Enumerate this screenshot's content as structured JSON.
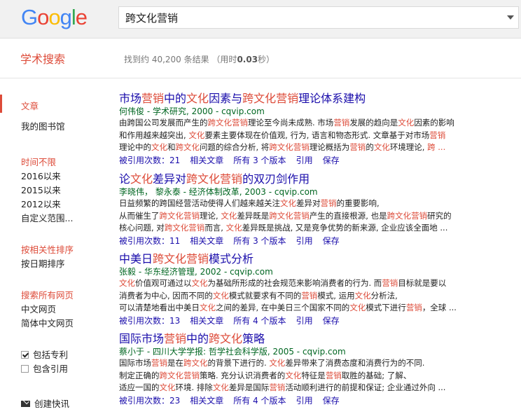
{
  "header": {
    "logo_letters": [
      {
        "ch": "G",
        "color": "#4285F4"
      },
      {
        "ch": "o",
        "color": "#EA4335"
      },
      {
        "ch": "o",
        "color": "#FBBC05"
      },
      {
        "ch": "g",
        "color": "#4285F4"
      },
      {
        "ch": "l",
        "color": "#34A853"
      },
      {
        "ch": "e",
        "color": "#EA4335"
      }
    ],
    "search_value": "跨文化营销"
  },
  "subbar": {
    "title": "学术搜索",
    "count_prefix": "找到约 40,200 条结果 （用时",
    "count_time": "0.03",
    "count_suffix": "秒）"
  },
  "sidebar": {
    "articles": "文章",
    "library": "我的图书馆",
    "time_header": "时间不限",
    "since_2016": "2016以来",
    "since_2015": "2015以来",
    "since_2012": "2012以来",
    "custom_range": "自定义范围...",
    "sort_relevance": "按相关性排序",
    "sort_date": "按日期排序",
    "search_all": "搜索所有网页",
    "chinese_pages": "中文网页",
    "simplified_pages": "简体中文网页",
    "include_patents": "包括专利",
    "include_citations": "包含引用",
    "create_alert": "创建快讯"
  },
  "results": [
    {
      "title": [
        [
          "市场",
          ""
        ],
        [
          "营销",
          "hl"
        ],
        [
          "中的",
          ""
        ],
        [
          "文化",
          "hl"
        ],
        [
          "因素与",
          ""
        ],
        [
          "跨文化营销",
          "hl"
        ],
        [
          "理论体系建构",
          ""
        ]
      ],
      "meta": "何伟俊 - 学术研究, 2000 - cqvip.com",
      "snippet": [
        [
          [
            "由跨国公司发展而产生的",
            ""
          ],
          [
            "跨文化营销",
            "hl"
          ],
          [
            "理论至今尚未成熟. 市场",
            ""
          ],
          [
            "营销",
            "hl"
          ],
          [
            "发展的趋向是",
            ""
          ],
          [
            "文化",
            "hl"
          ],
          [
            "因素的影响",
            ""
          ]
        ],
        [
          [
            "和作用越来越突出, ",
            ""
          ],
          [
            "文化",
            "hl"
          ],
          [
            "要素主要体现在价值观, 行为, 语言和物态形式. 文章基于对市场",
            ""
          ],
          [
            "营销",
            "hl"
          ]
        ],
        [
          [
            "理论中的",
            ""
          ],
          [
            "文化",
            "hl"
          ],
          [
            "和",
            ""
          ],
          [
            "跨文化",
            "hl"
          ],
          [
            "问题的综合分析, 将",
            ""
          ],
          [
            "跨文化营销",
            "hl"
          ],
          [
            "理论概括为",
            ""
          ],
          [
            "营销",
            "hl"
          ],
          [
            "的",
            ""
          ],
          [
            "文化",
            "hl"
          ],
          [
            "环境理论, ",
            ""
          ],
          [
            "跨 ...",
            "hl"
          ]
        ]
      ],
      "links": [
        "被引用次数：21",
        "相关文章",
        "所有 3 个版本",
        "引用",
        "保存"
      ]
    },
    {
      "title": [
        [
          "论",
          ""
        ],
        [
          "文化",
          "hl"
        ],
        [
          "差异对",
          ""
        ],
        [
          "跨文化营销",
          "hl"
        ],
        [
          "的双刃剑作用",
          ""
        ]
      ],
      "meta": "李晓伟， 黎永泰 - 经济体制改革, 2003 - cqvip.com",
      "snippet": [
        [
          [
            "日益频繁的跨国经营活动使得人们越来越关注",
            ""
          ],
          [
            "文化",
            "hl"
          ],
          [
            "差异对",
            ""
          ],
          [
            "营销",
            "hl"
          ],
          [
            "的重要影响,",
            ""
          ]
        ],
        [
          [
            "从而催生了",
            ""
          ],
          [
            "跨文化营销",
            "hl"
          ],
          [
            "理论, ",
            ""
          ],
          [
            "文化",
            "hl"
          ],
          [
            "差异既是",
            ""
          ],
          [
            "跨文化营销",
            "hl"
          ],
          [
            "产生的直接根源, 也是",
            ""
          ],
          [
            "跨文化营销",
            "hl"
          ],
          [
            "研究的",
            ""
          ]
        ],
        [
          [
            "核心问题, 对",
            ""
          ],
          [
            "跨文化营销",
            "hl"
          ],
          [
            "而言, ",
            ""
          ],
          [
            "文化",
            "hl"
          ],
          [
            "差异既是挑战, 又是竞争优势的新来源, 企业应该全面地 ...",
            ""
          ]
        ]
      ],
      "links": [
        "被引用次数：11",
        "相关文章",
        "所有 3 个版本",
        "引用",
        "保存"
      ]
    },
    {
      "title": [
        [
          "中美日",
          ""
        ],
        [
          "跨文化营销",
          "hl"
        ],
        [
          "模式分析",
          ""
        ]
      ],
      "meta": "张毅 - 华东经济管理, 2002 - cqvip.com",
      "snippet": [
        [
          [
            "文化",
            "hl"
          ],
          [
            "价值观可通过以",
            ""
          ],
          [
            "文化",
            "hl"
          ],
          [
            "为基础所形成的社会规范来影响消费者的行为. 而",
            ""
          ],
          [
            "营销",
            "hl"
          ],
          [
            "目标就是要以",
            ""
          ]
        ],
        [
          [
            "消费者为中心, 因而不同的",
            ""
          ],
          [
            "文化",
            "hl"
          ],
          [
            "模式就要求有不同的",
            ""
          ],
          [
            "营销",
            "hl"
          ],
          [
            "模式, 运用",
            ""
          ],
          [
            "文化",
            "hl"
          ],
          [
            "分析法,",
            ""
          ]
        ],
        [
          [
            "可以清楚地看出中美日",
            ""
          ],
          [
            "文化",
            "hl"
          ],
          [
            "之间的差异, 在中美日三个国家不同的",
            ""
          ],
          [
            "文化",
            "hl"
          ],
          [
            "模式下进行",
            ""
          ],
          [
            "营销",
            "hl"
          ],
          [
            "，全球 ...",
            ""
          ]
        ]
      ],
      "links": [
        "被引用次数：13",
        "相关文章",
        "所有 4 个版本",
        "引用",
        "保存"
      ]
    },
    {
      "title": [
        [
          "国际市场",
          ""
        ],
        [
          "营销",
          "hl"
        ],
        [
          "中的",
          ""
        ],
        [
          "跨文化",
          "hl"
        ],
        [
          "策略",
          ""
        ]
      ],
      "meta": "蔡小于 - 四川大学学报: 哲学社会科学版, 2005 - cqvip.com",
      "snippet": [
        [
          [
            "国际市场",
            ""
          ],
          [
            "营销",
            "hl"
          ],
          [
            "是在",
            ""
          ],
          [
            "跨文化",
            "hl"
          ],
          [
            "的背景下进行的. ",
            ""
          ],
          [
            "文化",
            "hl"
          ],
          [
            "差异带来了消费态度和消费行为的不同.",
            ""
          ]
        ],
        [
          [
            "制定正确的",
            ""
          ],
          [
            "跨文化营销",
            "hl"
          ],
          [
            "策略. 充分认识消费者的",
            ""
          ],
          [
            "文化",
            "hl"
          ],
          [
            "特征是",
            ""
          ],
          [
            "营销",
            "hl"
          ],
          [
            "取胜的基础; 了解、",
            ""
          ]
        ],
        [
          [
            "适应一国的",
            ""
          ],
          [
            "文化",
            "hl"
          ],
          [
            "环境. 排除",
            ""
          ],
          [
            "文化",
            "hl"
          ],
          [
            "差异是国际",
            ""
          ],
          [
            "营销",
            "hl"
          ],
          [
            "活动顺利进行的前提和保证; 企业通过外向 ...",
            ""
          ]
        ]
      ],
      "links": [
        "被引用次数：23",
        "相关文章",
        "所有 4 个版本",
        "引用",
        "保存"
      ]
    }
  ]
}
